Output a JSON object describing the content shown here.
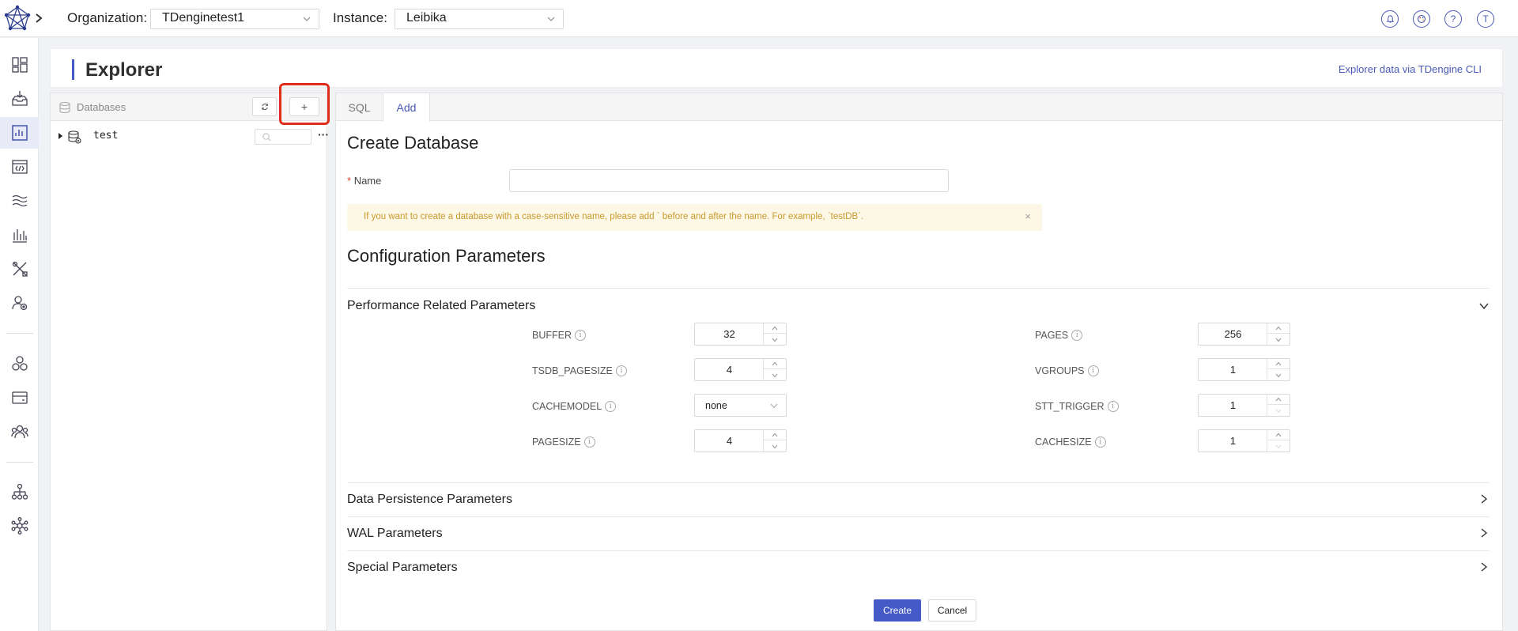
{
  "topbar": {
    "organization_label": "Organization:",
    "organization_value": "TDenginetest1",
    "instance_label": "Instance:",
    "instance_value": "Leibika",
    "icons": [
      "bell-icon",
      "palette-icon",
      "help-icon",
      "user-avatar-icon"
    ],
    "help_glyph": "?",
    "avatar_initial": "T"
  },
  "leftnav": {
    "items": [
      "dashboard-icon",
      "data-in-icon",
      "explorer-icon",
      "programming-icon",
      "streams-icon",
      "visualization-icon",
      "tools-icon",
      "users-icon",
      "instances-icon",
      "wallet-icon",
      "organization-icon",
      "hierarchy-icon",
      "network-icon"
    ],
    "active": "explorer-icon"
  },
  "header": {
    "title": "Explorer",
    "cli_link": "Explorer data via TDengine CLI"
  },
  "dbpanel": {
    "title": "Databases",
    "refresh_glyph": "↻",
    "add_glyph": "+",
    "tree": [
      {
        "name": "test"
      }
    ],
    "more_glyph": "···"
  },
  "main": {
    "tabs": [
      {
        "label": "SQL"
      },
      {
        "label": "Add"
      }
    ],
    "active_tab": "Add",
    "create_title": "Create Database",
    "name_label": "Name",
    "name_required": "*",
    "name_value": "",
    "alert_text": "If you want to create a database with a case-sensitive name, please add ` before and after the name. For example, `testDB`.",
    "alert_close": "×",
    "config_title": "Configuration Parameters",
    "groups": [
      {
        "title": "Performance Related Parameters",
        "expanded": true
      },
      {
        "title": "Data Persistence Parameters",
        "expanded": false
      },
      {
        "title": "WAL Parameters",
        "expanded": false
      },
      {
        "title": "Special Parameters",
        "expanded": false
      }
    ],
    "params_left": [
      {
        "label": "BUFFER",
        "value": "32",
        "type": "stepper"
      },
      {
        "label": "TSDB_PAGESIZE",
        "value": "4",
        "type": "stepper"
      },
      {
        "label": "CACHEMODEL",
        "value": "none",
        "type": "select"
      },
      {
        "label": "PAGESIZE",
        "value": "4",
        "type": "stepper"
      }
    ],
    "params_right": [
      {
        "label": "PAGES",
        "value": "256",
        "type": "stepper"
      },
      {
        "label": "VGROUPS",
        "value": "1",
        "type": "stepper"
      },
      {
        "label": "STT_TRIGGER",
        "value": "1",
        "type": "stepper"
      },
      {
        "label": "CACHESIZE",
        "value": "1",
        "type": "stepper"
      }
    ],
    "info_glyph": "i",
    "create_button": "Create",
    "cancel_button": "Cancel"
  },
  "colors": {
    "accent": "#4559c7",
    "highlight": "#e02d1b",
    "alert_bg": "#fdf7e6",
    "alert_text": "#c99a2c"
  }
}
